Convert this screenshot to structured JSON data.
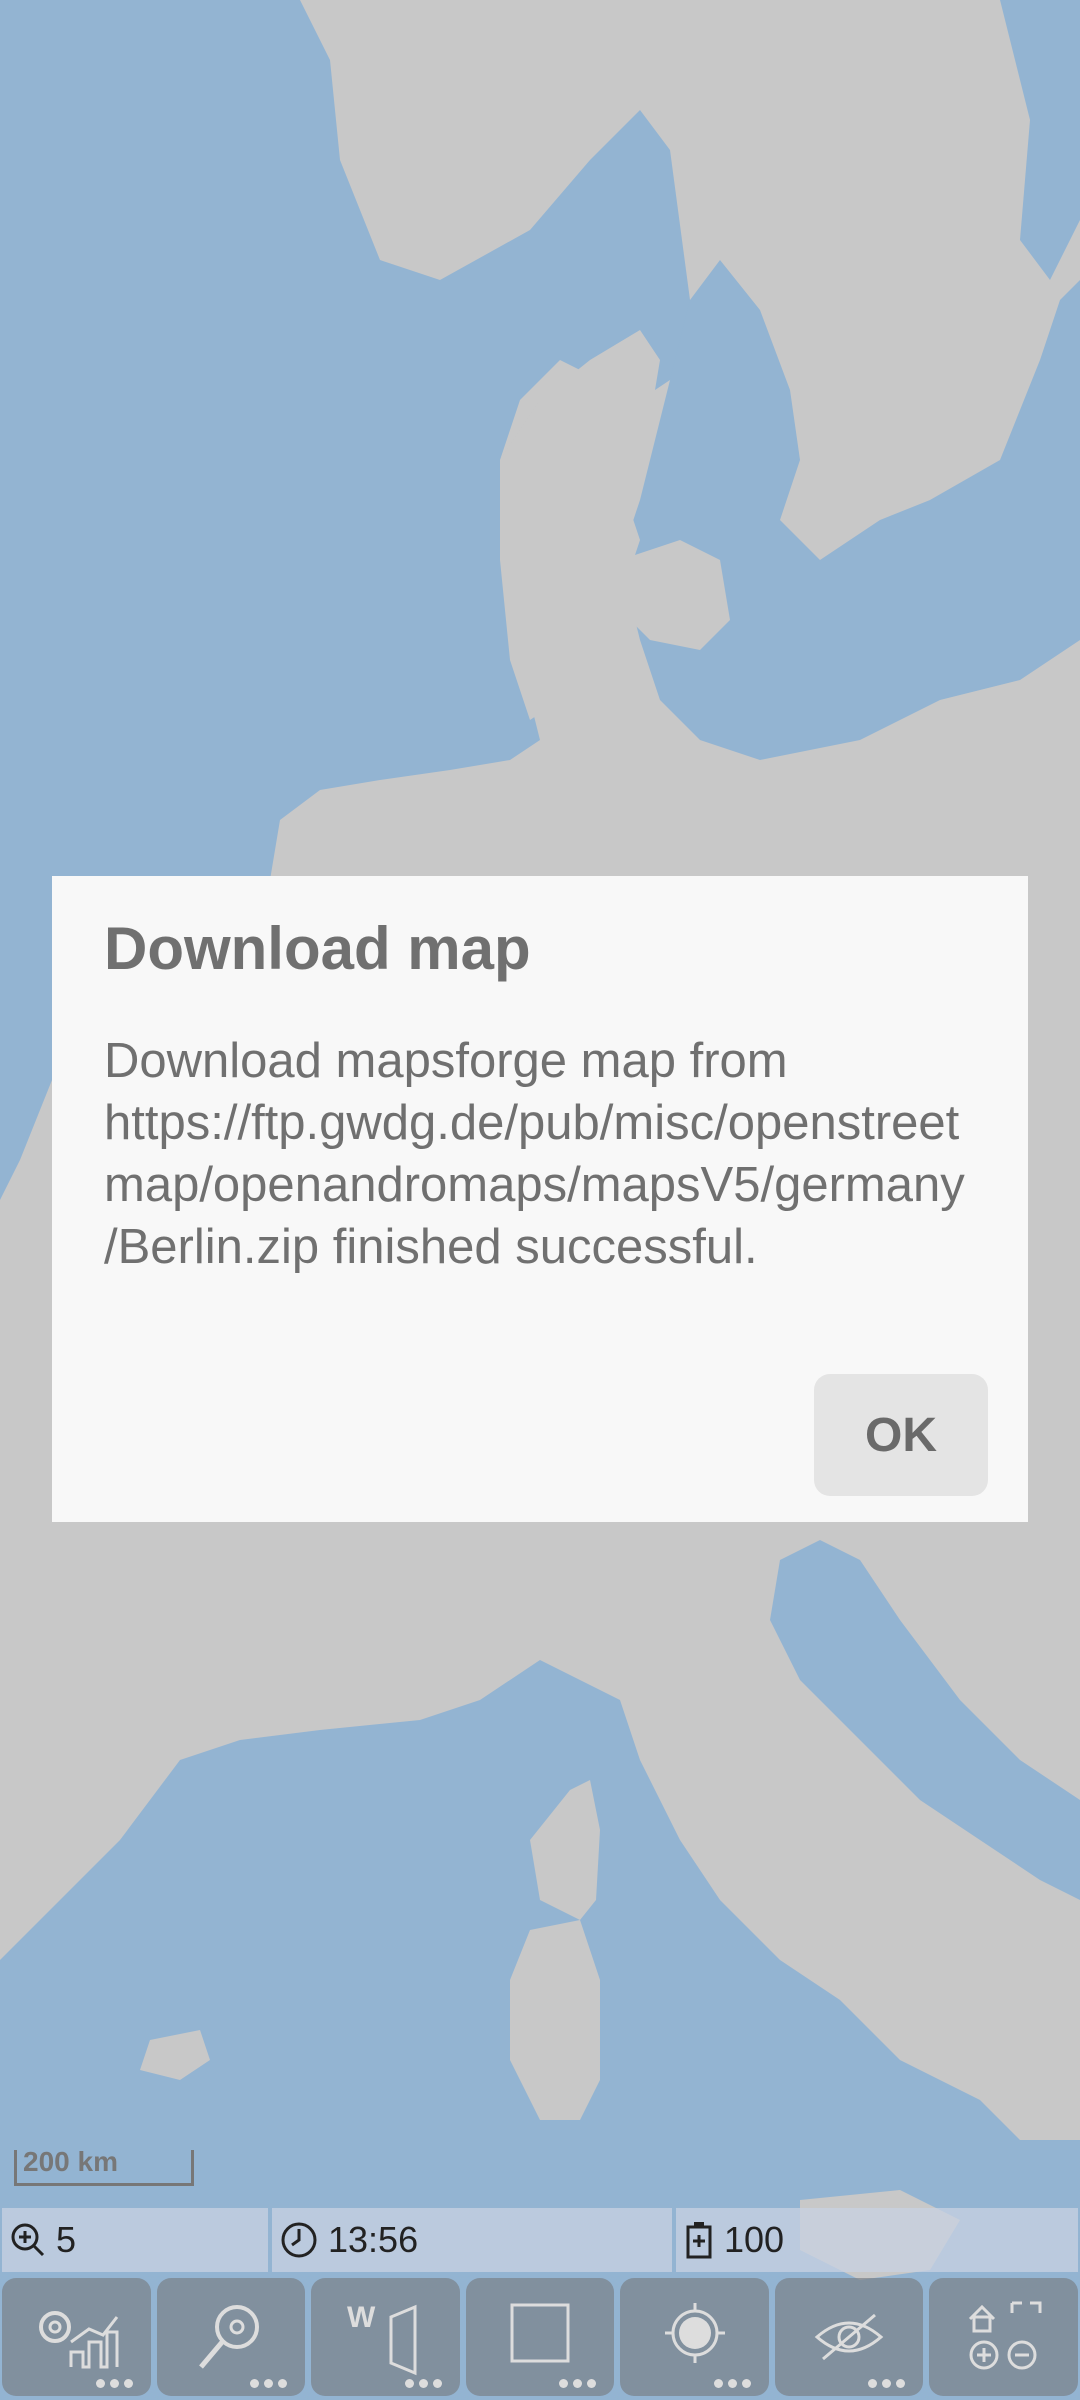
{
  "map": {
    "scale_label": "200 km",
    "colors": {
      "land": "#c8c8c8",
      "water": "#93b4d2"
    }
  },
  "dialog": {
    "title": "Download map",
    "message": "Download mapsforge map from https://ftp.gwdg.de/pub/misc/openstreetmap/openandromaps/mapsV5/germany/Berlin.zip finished successful.",
    "ok_label": "OK"
  },
  "status_bar": {
    "zoom": "5",
    "time": "13:56",
    "battery": "100"
  },
  "toolbar": {
    "buttons": [
      {
        "icon": "settings-stats-icon"
      },
      {
        "icon": "search-icon"
      },
      {
        "icon": "waypoint-route-icon"
      },
      {
        "icon": "area-select-icon"
      },
      {
        "icon": "gps-location-icon"
      },
      {
        "icon": "visibility-icon"
      },
      {
        "icon": "zoom-home-icon"
      }
    ]
  }
}
